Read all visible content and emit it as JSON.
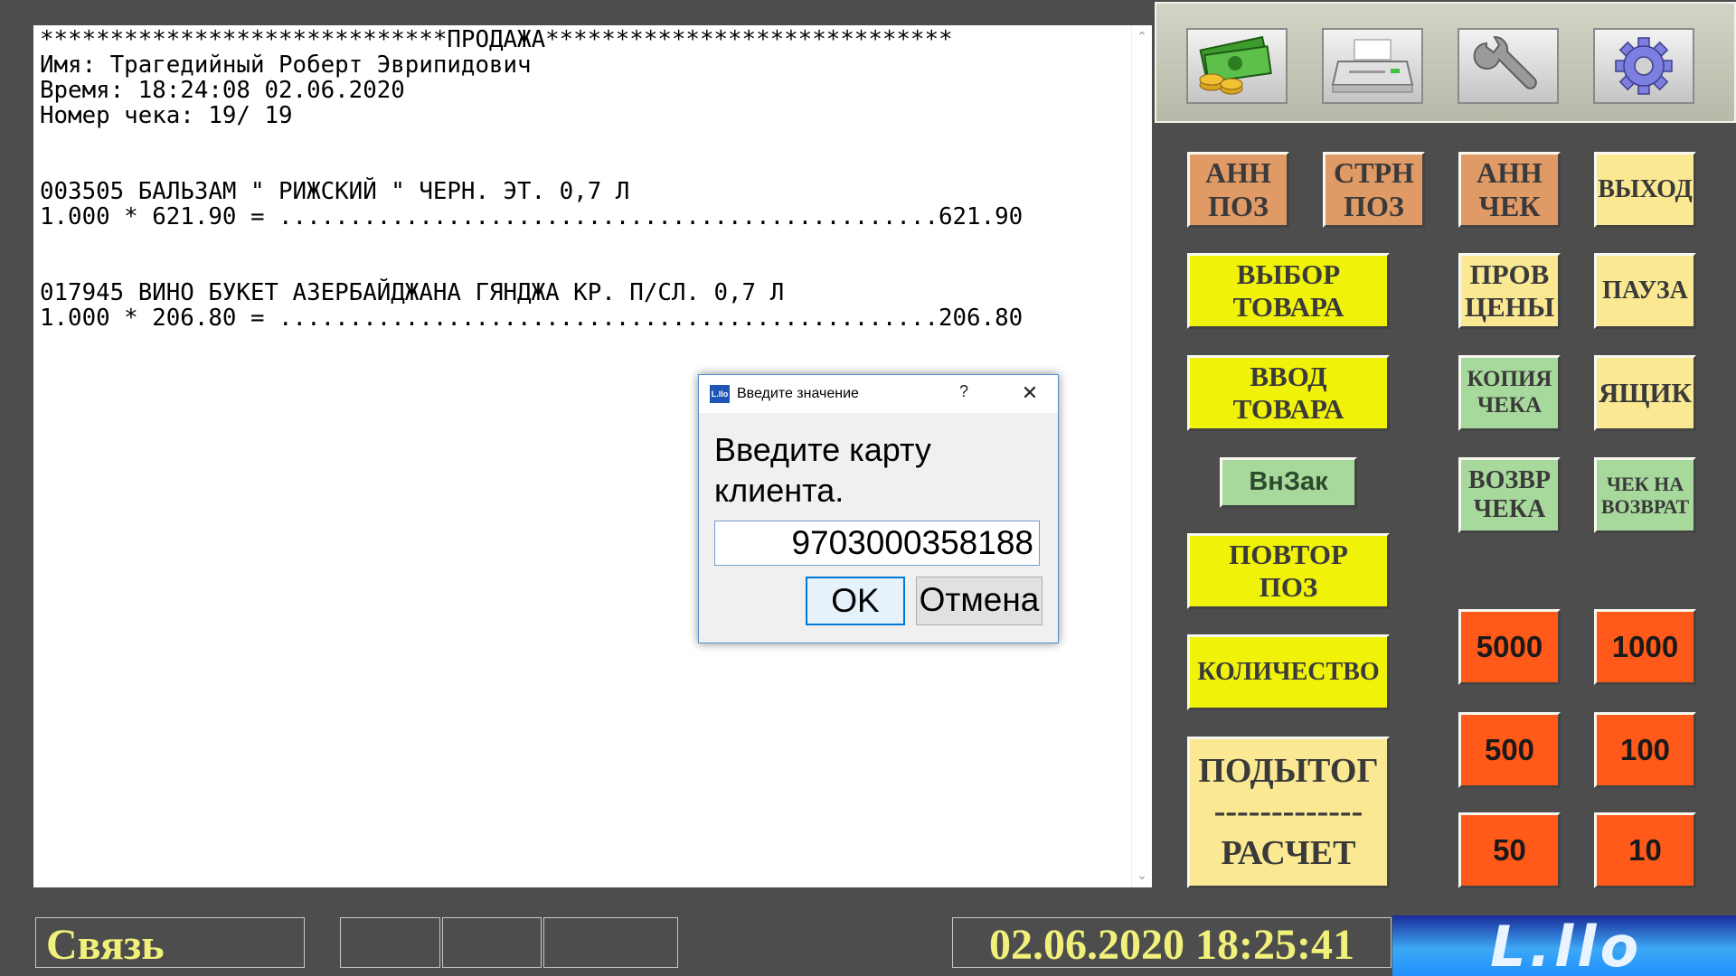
{
  "receipt": {
    "lines": [
      "*****************************ПРОДАЖА*****************************",
      "Имя: Трагедийный Роберт Эврипидович",
      "Время: 18:24:08 02.06.2020",
      "Номер чека: 19/ 19",
      "",
      "",
      "003505 БАЛЬЗАМ \" РИЖСКИЙ \" ЧЕРН. ЭТ. 0,7 Л",
      "1.000 * 621.90 = ...............................................621.90",
      "",
      "",
      "017945 ВИНО БУКЕТ АЗЕРБАЙДЖАНА ГЯНДЖА КР. П/СЛ. 0,7 Л",
      "1.000 * 206.80 = ...............................................206.80"
    ],
    "scroll_up": "⌃",
    "scroll_down": "⌄"
  },
  "toolbar": {
    "icons": [
      "cash-money-icon",
      "printer-icon",
      "wrench-icon",
      "gear-icon"
    ]
  },
  "keys": {
    "ann_poz": "АНН\nПОЗ",
    "strn_poz": "СТРН\nПОЗ",
    "ann_chek": "АНН\nЧЕК",
    "exit": "ВЫХОД",
    "choose_goods": "ВЫБОР\nТОВАРА",
    "check_price": "ПРОВ\nЦЕНЫ",
    "pause": "ПАУЗА",
    "enter_goods": "ВВОД\nТОВАРА",
    "receipt_copy": "КОПИЯ\nЧЕКА",
    "drawer": "ЯЩИК",
    "vnzak": "ВнЗак",
    "return_receipt": "ВОЗВР\nЧЕКА",
    "receipt_for_return": "ЧЕК НА\nВОЗВРАТ",
    "repeat_poz": "ПОВТОР\nПОЗ",
    "quantity": "КОЛИЧЕСТВО",
    "subtotal": "ПОДЫТОГ\n-------------\nРАСЧЕТ",
    "n5000": "5000",
    "n1000": "1000",
    "n500": "500",
    "n100": "100",
    "n50": "50",
    "n10": "10"
  },
  "dialog": {
    "title": "Введите значение",
    "icon_text": "L.llo",
    "help": "?",
    "close": "✕",
    "prompt": "Введите карту\nклиента.",
    "input_value": "9703000358188",
    "ok": "OK",
    "cancel": "Отмена"
  },
  "status": {
    "link": "Связь",
    "datetime": "02.06.2020 18:25:41",
    "logo_text": "L.llo"
  },
  "colors": {
    "background": "#4d4d4d",
    "orange_key": "#e09a66",
    "yellow_key": "#f1f20a",
    "light_yellow_key": "#fae892",
    "green_key": "#a8d99c",
    "red_key": "#ff5a19",
    "status_text": "#f0f07a"
  }
}
